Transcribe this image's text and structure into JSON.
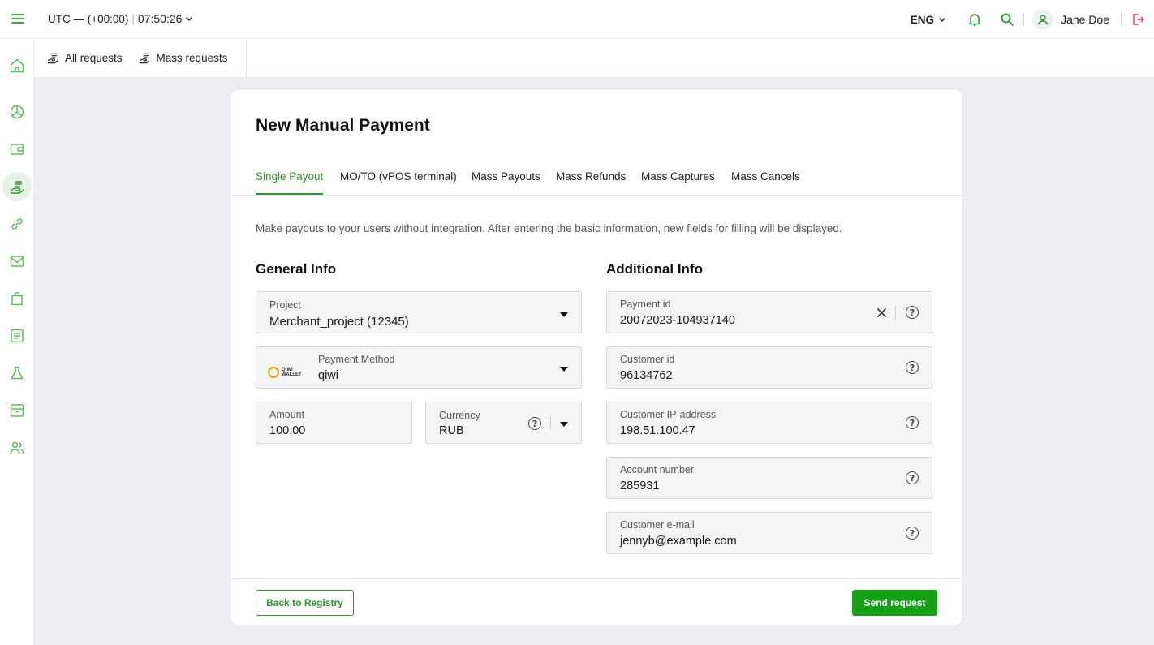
{
  "topbar": {
    "timezone": "UTC — (+00:00)",
    "time": "07:50:26",
    "language": "ENG",
    "user_name": "Jane Doe"
  },
  "subnav": {
    "items": [
      {
        "label": "All requests",
        "icon": "requests-icon"
      },
      {
        "label": "Mass requests",
        "icon": "mass-requests-icon"
      }
    ]
  },
  "sidebar": {
    "items": [
      {
        "icon": "home-icon"
      },
      {
        "icon": "pie-chart-icon"
      },
      {
        "icon": "wallet-icon"
      },
      {
        "icon": "payouts-icon",
        "active": true
      },
      {
        "icon": "link-icon"
      },
      {
        "icon": "mail-icon"
      },
      {
        "icon": "shopping-bag-icon"
      },
      {
        "icon": "document-icon"
      },
      {
        "icon": "flask-icon"
      },
      {
        "icon": "archive-icon"
      },
      {
        "icon": "users-icon"
      }
    ]
  },
  "card": {
    "title": "New Manual Payment",
    "tabs": [
      {
        "label": "Single Payout",
        "active": true
      },
      {
        "label": "MO/TO (vPOS terminal)"
      },
      {
        "label": "Mass Payouts"
      },
      {
        "label": "Mass Refunds"
      },
      {
        "label": "Mass Captures"
      },
      {
        "label": "Mass Cancels"
      }
    ],
    "description": "Make payouts to your users without integration. After entering the basic information, new fields for filling will be displayed."
  },
  "general": {
    "title": "General Info",
    "project": {
      "label": "Project",
      "value": "Merchant_project (12345)"
    },
    "payment_method": {
      "label": "Payment Method",
      "value": "qiwi",
      "logo_text": "QIWI WALLET"
    },
    "amount": {
      "label": "Amount",
      "value": "100.00"
    },
    "currency": {
      "label": "Currency",
      "value": "RUB"
    }
  },
  "additional": {
    "title": "Additional Info",
    "payment_id": {
      "label": "Payment id",
      "value": "20072023-104937140"
    },
    "customer_id": {
      "label": "Customer id",
      "value": "96134762"
    },
    "customer_ip": {
      "label": "Customer IP-address",
      "value": "198.51.100.47"
    },
    "account_number": {
      "label": "Account number",
      "value": "285931"
    },
    "customer_email": {
      "label": "Customer e-mail",
      "value": "jennyb@example.com"
    }
  },
  "footer": {
    "back_label": "Back to Registry",
    "send_label": "Send request"
  },
  "colors": {
    "accent": "#2a9a2a",
    "primary_button": "#16a016",
    "background": "#ebedf1"
  }
}
